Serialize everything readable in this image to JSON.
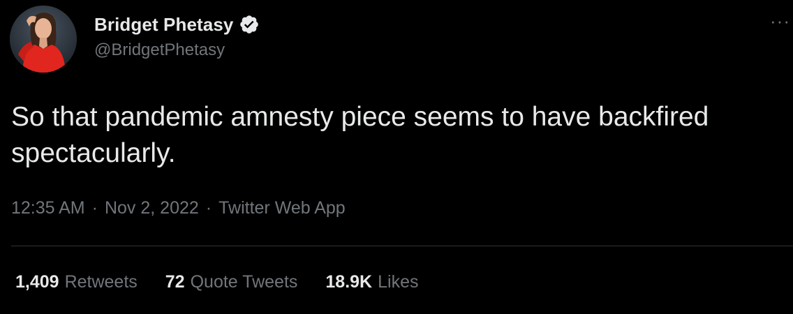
{
  "author": {
    "display_name": "Bridget Phetasy",
    "handle": "@BridgetPhetasy",
    "verified": true,
    "avatar_icon": "profile-photo"
  },
  "more_menu": {
    "icon": "more-icon",
    "label": "···"
  },
  "tweet": {
    "text": "So that pandemic amnesty piece seems to have backfired spectacularly."
  },
  "meta": {
    "time": "12:35 AM",
    "separator": "·",
    "date": "Nov 2, 2022",
    "source": "Twitter Web App"
  },
  "stats": [
    {
      "count": "1,409",
      "label": "Retweets"
    },
    {
      "count": "72",
      "label": "Quote Tweets"
    },
    {
      "count": "18.9K",
      "label": "Likes"
    }
  ],
  "colors": {
    "background": "#000000",
    "text_primary": "#e7e9ea",
    "text_secondary": "#71767b",
    "divider": "#2f3336",
    "avatar_shirt": "#e0261f"
  }
}
